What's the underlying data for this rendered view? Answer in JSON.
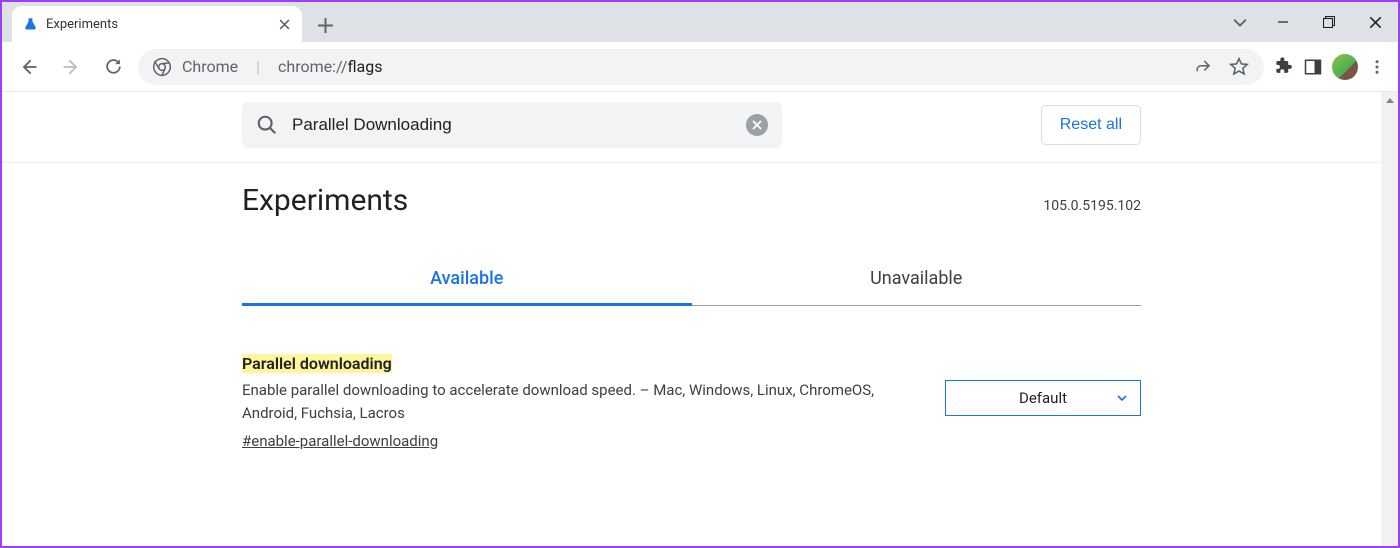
{
  "window": {
    "tab_title": "Experiments"
  },
  "omnibox": {
    "prefix_label": "Chrome",
    "url_display_prefix": "chrome://",
    "url_display_path": "flags"
  },
  "search": {
    "value": "Parallel Downloading"
  },
  "reset_label": "Reset all",
  "page": {
    "title": "Experiments",
    "version": "105.0.5195.102"
  },
  "tabs": {
    "available": "Available",
    "unavailable": "Unavailable"
  },
  "flag": {
    "title": "Parallel downloading",
    "description": "Enable parallel downloading to accelerate download speed. – Mac, Windows, Linux, ChromeOS, Android, Fuchsia, Lacros",
    "anchor": "#enable-parallel-downloading",
    "select_value": "Default"
  }
}
